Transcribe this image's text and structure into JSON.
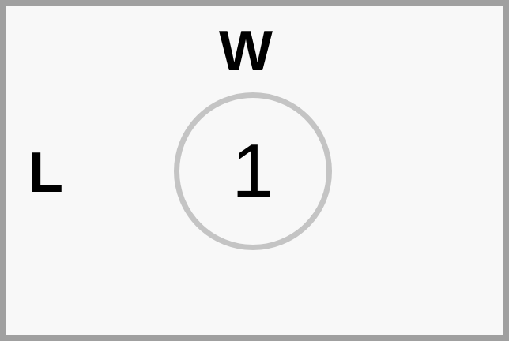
{
  "diagram": {
    "top_label": "W",
    "left_label": "L",
    "circle_number": "1"
  },
  "colors": {
    "frame_border": "#a0a0a0",
    "background": "#f8f8f8",
    "circle_stroke": "#c4c4c4",
    "text": "#000000"
  }
}
